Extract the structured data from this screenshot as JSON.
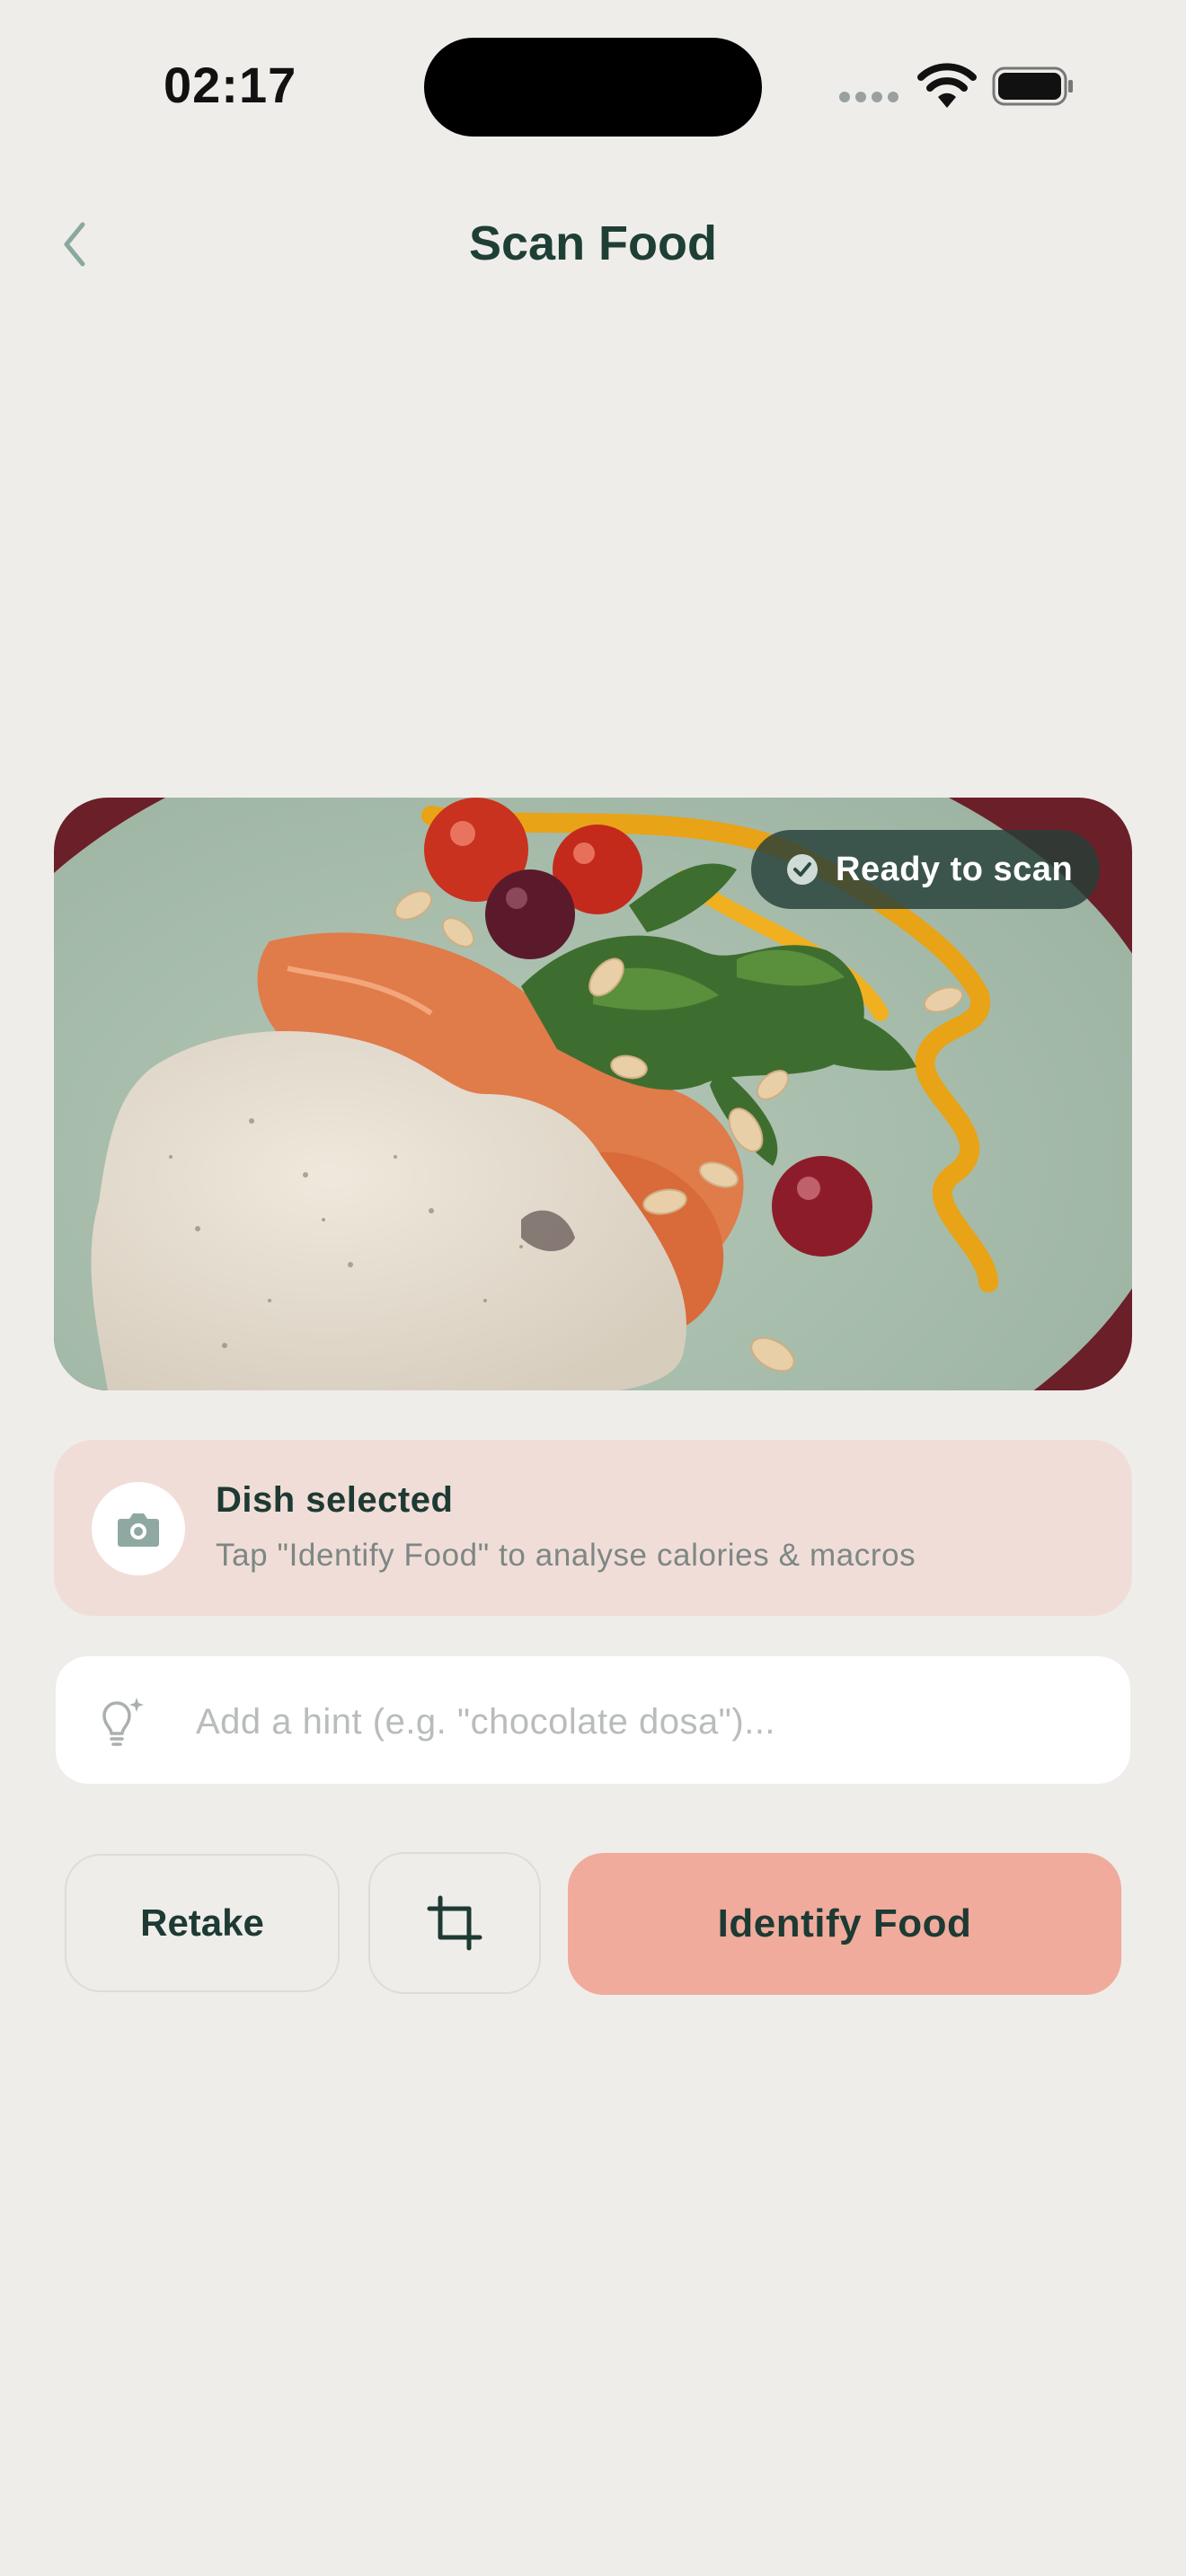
{
  "status_bar": {
    "time": "02:17"
  },
  "header": {
    "title": "Scan Food",
    "back_icon": "chevron-left-icon"
  },
  "photo": {
    "badge_label": "Ready to scan",
    "badge_icon": "check-circle-icon"
  },
  "info_card": {
    "title": "Dish selected",
    "subtitle": "Tap \"Identify Food\" to analyse calories & macros",
    "icon": "camera-icon"
  },
  "hint": {
    "placeholder": "Add a hint (e.g. \"chocolate dosa\")...",
    "value": "",
    "icon": "lightbulb-sparkle-icon"
  },
  "actions": {
    "retake_label": "Retake",
    "crop_icon": "crop-icon",
    "identify_label": "Identify Food"
  },
  "colors": {
    "background": "#efedea",
    "primary_text": "#1d3a33",
    "accent": "#f0ab9c",
    "card_tint": "#f1ddd7",
    "badge_bg": "#2d4a42"
  }
}
